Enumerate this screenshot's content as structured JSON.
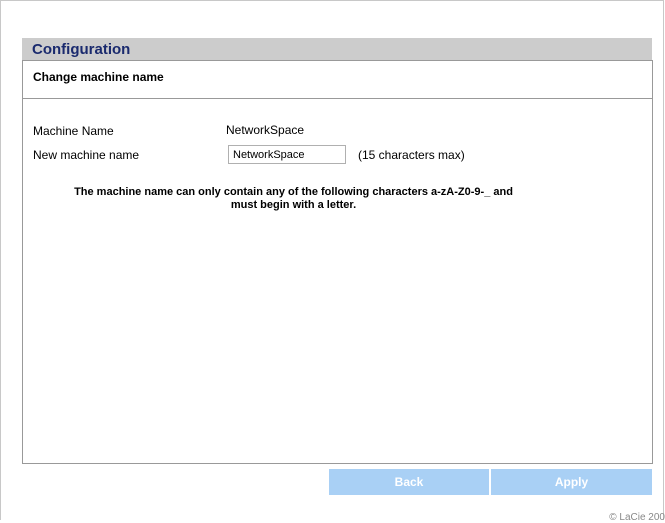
{
  "section": {
    "title": "Configuration"
  },
  "panel": {
    "subtitle": "Change machine name",
    "machine_name_label": "Machine Name",
    "machine_name_value": "NetworkSpace",
    "new_name_label": "New machine name",
    "new_name_input_value": "NetworkSpace",
    "max_hint": "(15 characters max)",
    "notice_line1": "The machine name can only contain any of the following characters a-zA-Z0-9-_ and",
    "notice_line2": "must begin with a letter."
  },
  "buttons": {
    "back_label": "Back",
    "apply_label": "Apply"
  },
  "footer": {
    "copyright": "© LaCie 200"
  },
  "colors": {
    "header_bg": "#cccccc",
    "title_color": "#1a2a6e",
    "button_bg": "#a9d0f5"
  }
}
